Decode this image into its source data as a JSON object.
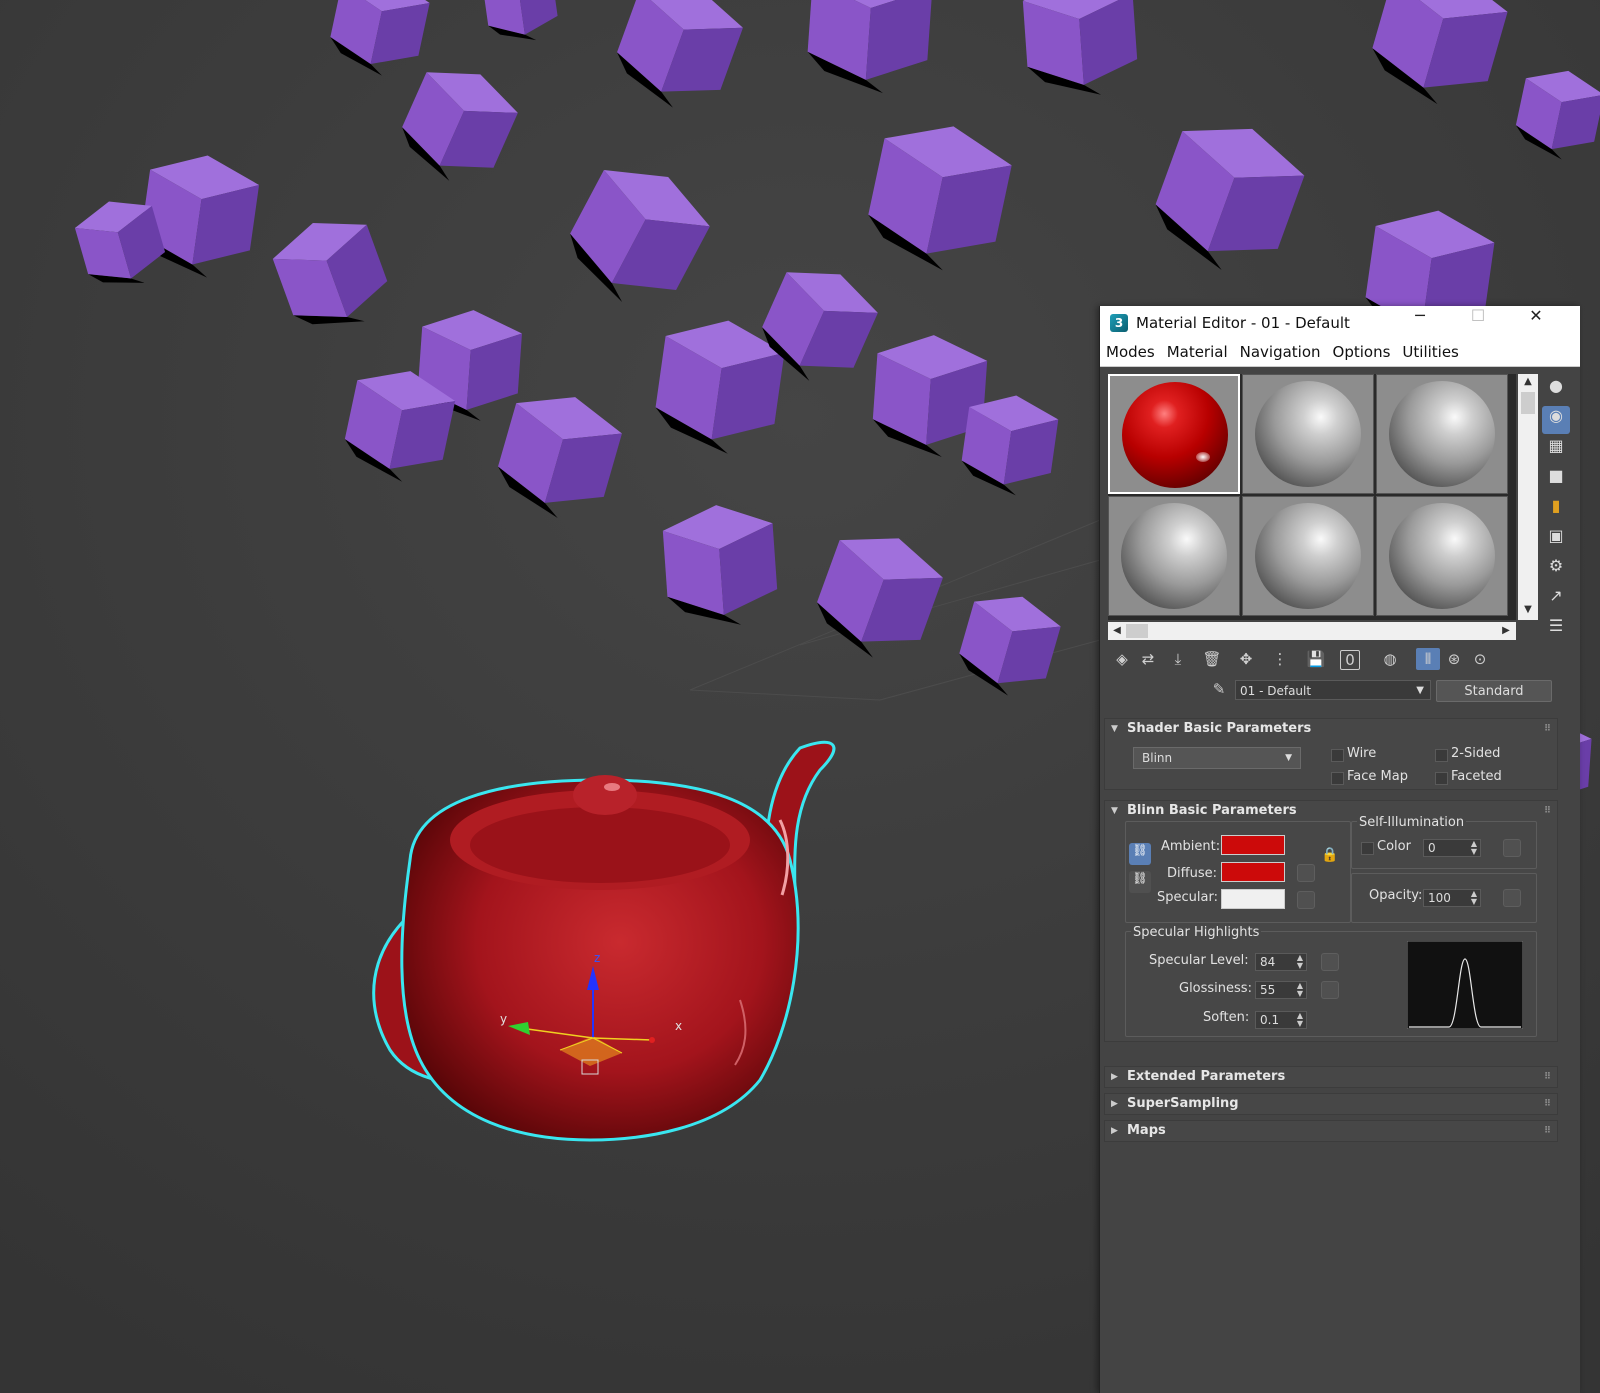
{
  "window": {
    "title": "Material Editor - 01 - Default",
    "app_icon": "3",
    "minimize": "─",
    "maximize": "☐",
    "close": "✕"
  },
  "menu": [
    "Modes",
    "Material",
    "Navigation",
    "Options",
    "Utilities"
  ],
  "material_name": "01 - Default",
  "material_type": "Standard",
  "shader_basic": {
    "header": "Shader Basic Parameters",
    "shader": "Blinn",
    "wire": "Wire",
    "two_sided": "2-Sided",
    "face_map": "Face Map",
    "faceted": "Faceted"
  },
  "blinn_basic": {
    "header": "Blinn Basic Parameters",
    "self_illum_label": "Self-Illumination",
    "color_label": "Color",
    "color_value": "0",
    "ambient_label": "Ambient:",
    "diffuse_label": "Diffuse:",
    "specular_label": "Specular:",
    "opacity_label": "Opacity:",
    "opacity_value": "100",
    "ambient_color": "#cc0a0a",
    "diffuse_color": "#cc0a0a",
    "specular_color": "#f0f0f0",
    "spec_highlights_label": "Specular Highlights",
    "spec_level_label": "Specular Level:",
    "spec_level_value": "84",
    "glossiness_label": "Glossiness:",
    "glossiness_value": "55",
    "soften_label": "Soften:",
    "soften_value": "0.1"
  },
  "collapsed_rollouts": [
    "Extended Parameters",
    "SuperSampling",
    "Maps"
  ],
  "viewport": {
    "axis_x": "x",
    "axis_y": "y",
    "axis_z": "z",
    "teapot_color": "#a8151e",
    "selection_outline": "#3ae6f0",
    "cube_color": "#8a55c8"
  },
  "icons": {
    "sample_type": "sphere-icon",
    "backlight": "backlight-icon",
    "background": "checker-icon",
    "uv_tiling": "tiling-icon",
    "video_color": "video-color-icon",
    "eyedropper": "eyedropper-icon"
  }
}
